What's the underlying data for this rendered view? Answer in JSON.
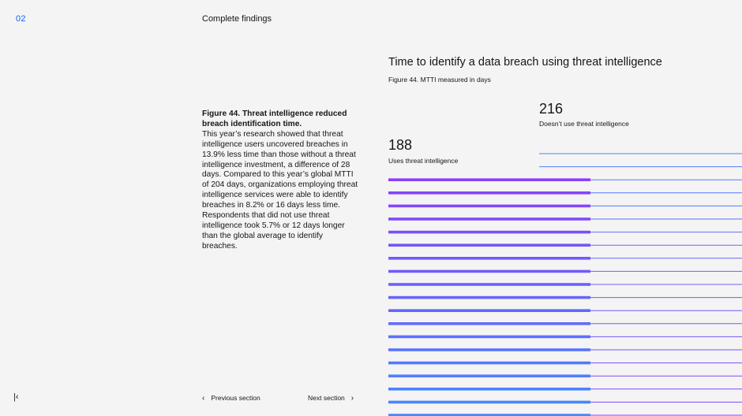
{
  "header": {
    "section_number": "02",
    "section_title": "Complete findings"
  },
  "body": {
    "lead": "Figure 44. Threat intelligence reduced breach identification time.",
    "text": "This year’s research showed that threat intelligence users uncovered breaches in 13.9% less time than those without a threat intelligence investment, a difference of 28 days. Compared to this year’s global MTTI of 204 days, organizations employing threat intelligence services were able to identify breaches in 8.2% or 16 days less time. Respondents that did not use threat intelligence took 5.7% or 12 days longer than the global average to identify breaches."
  },
  "chart_data": {
    "type": "bar",
    "title": "Time to identify a data breach using threat intelligence",
    "subtitle": "Figure 44. MTTI measured in days",
    "categories": [
      "Uses threat intelligence",
      "Doesn’t use threat intelligence"
    ],
    "values": [
      188,
      216
    ],
    "value_labels": [
      "188",
      "216"
    ],
    "colors": {
      "bar_top": "#8a3ffc",
      "bar_bottom": "#4589ff"
    }
  },
  "nav": {
    "first_icon": "first-page-icon",
    "first_glyph": "|‹",
    "prev_label": "Previous section",
    "next_label": "Next section",
    "prev_icon": "chevron-left-icon",
    "next_icon": "chevron-right-icon"
  }
}
